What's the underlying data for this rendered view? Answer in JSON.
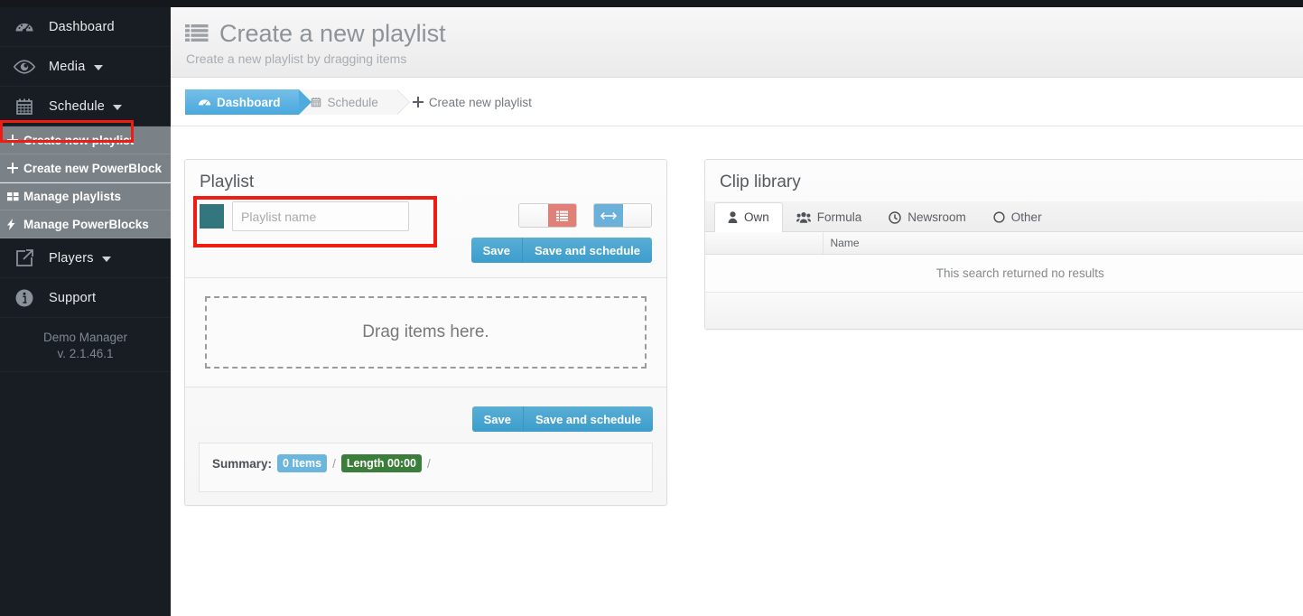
{
  "brand": {
    "accent_blue": "#49a8dd",
    "accent_teal": "#34767e",
    "highlight_red": "#ee1c13",
    "sidebar_dark": "#181d23",
    "submenu_gray": "#7b8287"
  },
  "sidebar": {
    "items": [
      {
        "label": "Dashboard",
        "icon": "dashboard-gauge-icon",
        "caret": false
      },
      {
        "label": "Media",
        "icon": "eye-icon",
        "caret": true
      },
      {
        "label": "Schedule",
        "icon": "calendar-icon",
        "caret": true
      }
    ],
    "submenu": [
      {
        "label": "Create new playlist",
        "icon": "plus-icon",
        "highlighted": true
      },
      {
        "label": "Create new PowerBlock",
        "icon": "plus-icon",
        "highlighted": false
      },
      {
        "label": "Manage playlists",
        "icon": "grid-icon",
        "highlighted": false
      },
      {
        "label": "Manage PowerBlocks",
        "icon": "bolt-icon",
        "highlighted": false
      }
    ],
    "items_after": [
      {
        "label": "Players",
        "icon": "external-link-icon",
        "caret": true
      },
      {
        "label": "Support",
        "icon": "info-circle-icon",
        "caret": false
      }
    ],
    "footer": {
      "name": "Demo Manager",
      "version": "v. 2.1.46.1"
    }
  },
  "header": {
    "icon": "th-list-icon",
    "title": "Create a new playlist",
    "subtitle": "Create a new playlist by dragging items"
  },
  "breadcrumb": [
    {
      "label": "Dashboard",
      "icon": "dashboard-gauge-icon",
      "active": true
    },
    {
      "label": "Schedule",
      "icon": "calendar-icon",
      "active": false
    },
    {
      "label": "Create new playlist",
      "icon": "plus-icon",
      "active": false
    }
  ],
  "playlist": {
    "title": "Playlist",
    "color_swatch": "#34767e",
    "name_value": "",
    "name_placeholder": "Playlist name",
    "toggles": [
      {
        "name": "list-view-toggle",
        "state": "right",
        "icon": "list-icon",
        "active_color": "#e08076"
      },
      {
        "name": "stretch-toggle",
        "state": "left",
        "icon": "arrows-h-icon",
        "active_color": "#6ab0d8"
      }
    ],
    "save_label": "Save",
    "save_schedule_label": "Save and schedule",
    "dropzone_text": "Drag items here.",
    "summary": {
      "label": "Summary:",
      "items_badge": "0 Items",
      "length_badge": "Length 00:00",
      "separator": "/",
      "trailing_separator": "/"
    }
  },
  "clip_library": {
    "title": "Clip library",
    "tabs": [
      {
        "label": "Own",
        "icon": "user-icon",
        "active": true
      },
      {
        "label": "Formula",
        "icon": "users-icon",
        "active": false
      },
      {
        "label": "Newsroom",
        "icon": "clock-icon",
        "active": false
      },
      {
        "label": "Other",
        "icon": "circle-o-icon",
        "active": false
      }
    ],
    "columns": [
      "",
      "Name"
    ],
    "empty_message": "This search returned no results"
  }
}
